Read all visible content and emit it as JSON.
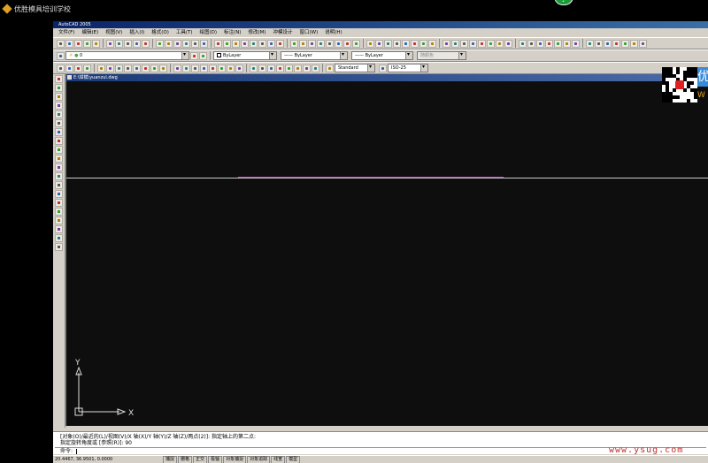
{
  "outer_window": {
    "title": "优胜模具培训学校"
  },
  "app": {
    "title": "AutoCAD 2005",
    "menus": [
      "文件(F)",
      "编辑(E)",
      "视图(V)",
      "插入(I)",
      "格式(O)",
      "工具(T)",
      "绘图(D)",
      "标注(N)",
      "修改(M)",
      "冲模设计",
      "窗口(W)",
      "说明(H)"
    ]
  },
  "layers_toolbar": {
    "layer": "0",
    "color": "ByLayer",
    "linetype": "ByLayer",
    "lineweight": "ByLayer",
    "plotstyle": "随颜色"
  },
  "styles_toolbar": {
    "text_style": "Standard",
    "dim_style": "ISO-25",
    "std_label": "STT"
  },
  "drawing": {
    "title": "E:\\钳模\\yuanzui.dwg",
    "ucs_x": "X",
    "ucs_y": "Y"
  },
  "command_line": {
    "history_1": "[对象(O)/最近的(L)/视图(V)/X 轴(X)/Y 轴(Y)/Z 轴(Z)/两点(2)]: 指定轴上的第二点:",
    "history_2": "指定旋转角度或 [参照(R)]: 90",
    "prompt": "命令:"
  },
  "status_bar": {
    "coords": "20.4467, 36.9501, 0.0000",
    "buttons": [
      "捕捉",
      "栅格",
      "正交",
      "极轴",
      "对象捕捉",
      "对象追踪",
      "线宽",
      "模型"
    ]
  },
  "ad": {
    "brand_char": "优",
    "brand_char2": "W"
  },
  "watermark": "www.ysug.com",
  "colors": {
    "app_bg": "#d4d0c8",
    "drawing_bg": "#0e0e0e",
    "polyline": "#c040c0"
  }
}
